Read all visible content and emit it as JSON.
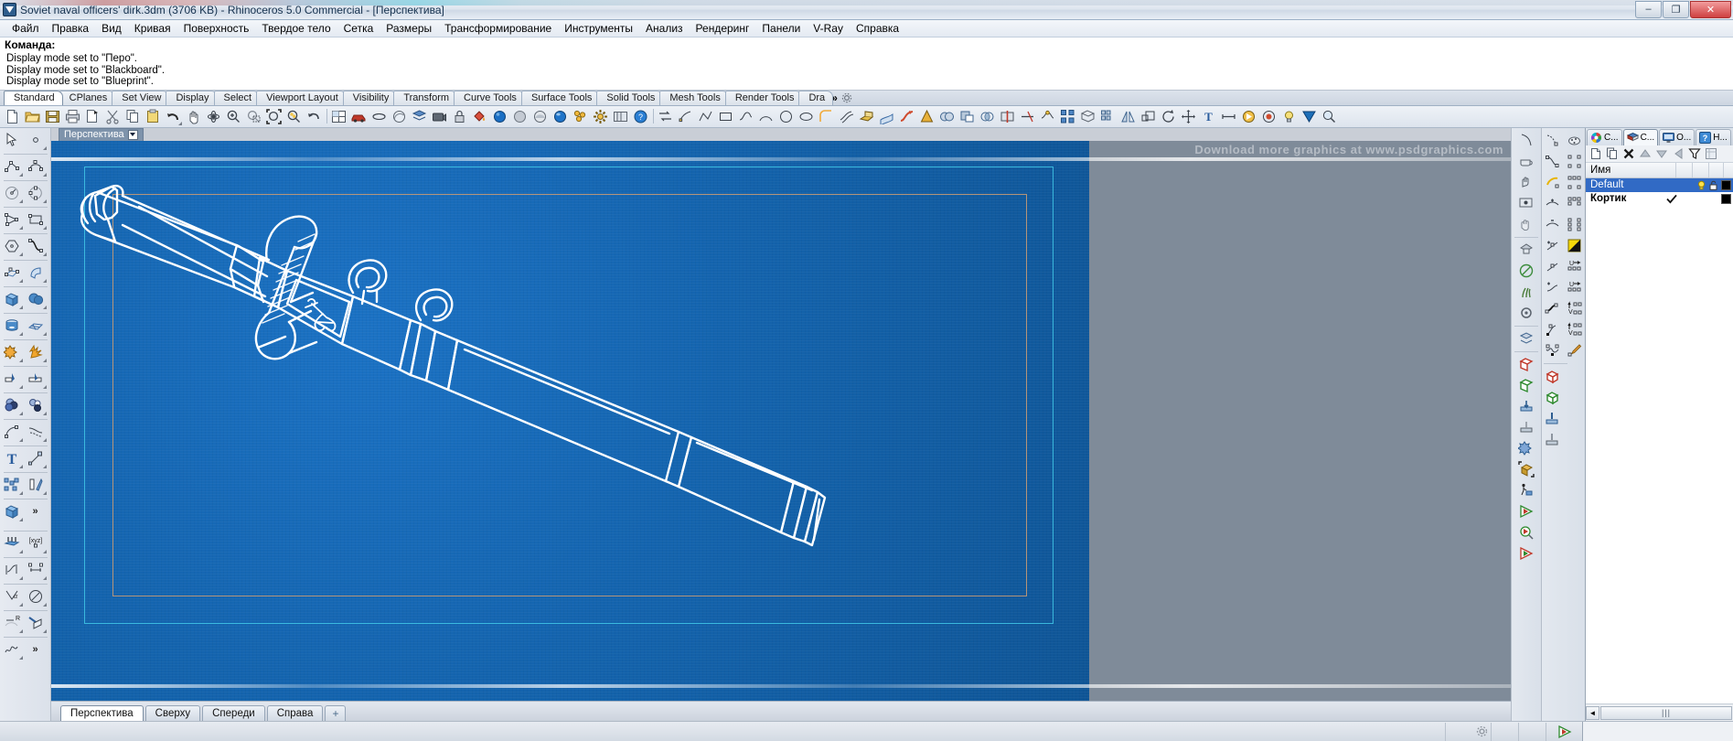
{
  "window": {
    "title": "Soviet naval officers' dirk.3dm (3706 KB) - Rhinoceros 5.0 Commercial - [Перспектива]",
    "icon": "rhino-app-icon",
    "minimize_label": "–",
    "maximize_label": "❐",
    "close_label": "✕"
  },
  "menubar": {
    "items": [
      {
        "label": "Файл"
      },
      {
        "label": "Правка"
      },
      {
        "label": "Вид"
      },
      {
        "label": "Кривая"
      },
      {
        "label": "Поверхность"
      },
      {
        "label": "Твердое тело"
      },
      {
        "label": "Сетка"
      },
      {
        "label": "Размеры"
      },
      {
        "label": "Трансформирование"
      },
      {
        "label": "Инструменты"
      },
      {
        "label": "Анализ"
      },
      {
        "label": "Рендеринг"
      },
      {
        "label": "Панели"
      },
      {
        "label": "V-Ray"
      },
      {
        "label": "Справка"
      }
    ]
  },
  "command_area": {
    "history": [
      "Display mode set to \"Перо\".",
      "Display mode set to \"Blackboard\".",
      "Display mode set to \"Blueprint\"."
    ],
    "prompt_label": "Команда:",
    "prompt_value": ""
  },
  "toolbar_tabs": {
    "items": [
      {
        "label": "Standard",
        "active": true
      },
      {
        "label": "CPlanes",
        "active": false
      },
      {
        "label": "Set View",
        "active": false
      },
      {
        "label": "Display",
        "active": false
      },
      {
        "label": "Select",
        "active": false
      },
      {
        "label": "Viewport Layout",
        "active": false
      },
      {
        "label": "Visibility",
        "active": false
      },
      {
        "label": "Transform",
        "active": false
      },
      {
        "label": "Curve Tools",
        "active": false
      },
      {
        "label": "Surface Tools",
        "active": false
      },
      {
        "label": "Solid Tools",
        "active": false
      },
      {
        "label": "Mesh Tools",
        "active": false
      },
      {
        "label": "Render Tools",
        "active": false
      },
      {
        "label": "Dra",
        "active": false
      }
    ],
    "overflow_label": "»",
    "options_icon": "gear-icon"
  },
  "main_toolbar": {
    "icons": [
      "new-file-icon",
      "open-folder-icon",
      "save-icon",
      "print-icon",
      "copy-to-clipboard-icon",
      "cut-scissors-icon",
      "copy-icon",
      "paste-icon",
      "undo-icon",
      "pan-hand-icon",
      "rotate-view-icon",
      "zoom-in-icon",
      "zoom-window-icon",
      "zoom-extents-icon",
      "zoom-selected-icon",
      "zoom-previous-icon",
      "viewport-layout-icon",
      "render-car-icon",
      "shade-icon",
      "render-preview-icon",
      "layers-icon",
      "camera-icon",
      "lock-icon",
      "paint-bucket-icon",
      "sphere-blue-icon",
      "sphere-grey-icon",
      "cylinder-icon",
      "render-ball-icon",
      "properties-icon",
      "settings-gear-icon",
      "toolbar-icon",
      "help-icon"
    ],
    "right_icons": [
      "arrow-swap-icon",
      "point-icon",
      "polyline-icon",
      "rectangle-icon",
      "curve-icon",
      "arc-icon",
      "circle-icon",
      "ellipse-icon",
      "fillet-icon",
      "offset-icon",
      "extrude-icon",
      "loft-icon",
      "sweep-icon",
      "revolve-icon",
      "boolean-union-icon",
      "boolean-difference-icon",
      "boolean-intersect-icon",
      "split-icon",
      "trim-icon",
      "join-icon",
      "explode-icon",
      "mesh-icon",
      "array-icon",
      "mirror-icon",
      "scale-icon",
      "rotate-icon",
      "move-icon",
      "text-icon",
      "dimension-icon",
      "render-icon",
      "material-icon",
      "light-icon",
      "vray-icon",
      "analyze-icon"
    ]
  },
  "left_toolbar": {
    "rows": [
      [
        "select-arrow-icon",
        "point-icon"
      ],
      [
        "polyline-icon",
        "control-point-curve-icon"
      ],
      [
        "circle-icon",
        "ellipse-icon"
      ],
      [
        "arc-icon",
        "rectangle-icon"
      ],
      [
        "polygon-icon",
        "curve-interpolate-icon"
      ],
      [
        "surface-from-points-icon",
        "surface-extrude-icon"
      ],
      [
        "box-icon",
        "sphere-icon"
      ],
      [
        "cylinder-icon",
        "surface-network-icon"
      ],
      [
        "boolean-union-icon",
        "explode-icon"
      ],
      [
        "split-icon",
        "trim-icon"
      ],
      [
        "boolean-2obj-icon",
        "boolean-difference-icon"
      ],
      [
        "fillet-curve-icon",
        "offset-curve-icon"
      ],
      [
        "text-icon",
        "scale-icon"
      ],
      [
        "array-icon",
        "mirror-icon"
      ],
      [
        "solid-tools-icon",
        "more-tools-icon"
      ]
    ],
    "rows2": [
      [
        "extrude-surface-icon",
        "cplane-xyz-icon"
      ],
      [
        "dim-aligned-icon",
        "dim-linear-icon"
      ],
      [
        "dim-angle-icon",
        "dim-diameter-icon"
      ],
      [
        "dim-radius-icon",
        "dim-leader-icon"
      ],
      [
        "curve-blend-icon",
        "more-tools-icon"
      ]
    ],
    "overflow_label": "»"
  },
  "viewport": {
    "name": "Перспектива",
    "dropdown_icon": "chevron-down-icon",
    "watermark": "Download more graphics at www.psdgraphics.com",
    "background_color": "#1464ae",
    "frame_cyan_color": "#41c8e8",
    "frame_tan_color": "#c79a74",
    "line_color": "#ffffff",
    "display_mode": "Blueprint",
    "model_name": "Soviet naval officers' dirk",
    "tabs": [
      {
        "label": "Перспектива",
        "active": true
      },
      {
        "label": "Сверху",
        "active": false
      },
      {
        "label": "Спереди",
        "active": false
      },
      {
        "label": "Справа",
        "active": false
      },
      {
        "label": "+",
        "active": false
      }
    ]
  },
  "layer_panel": {
    "tabs": [
      {
        "label": "C...",
        "icon": "color-wheel-icon",
        "active": false
      },
      {
        "label": "C...",
        "icon": "layers-stack-icon",
        "active": true
      },
      {
        "label": "O...",
        "icon": "display-monitor-icon",
        "active": false
      },
      {
        "label": "H...",
        "icon": "help-question-icon",
        "active": false
      }
    ],
    "toolbar": [
      "new-layer-icon",
      "duplicate-layer-icon",
      "delete-layer-icon",
      "move-up-icon",
      "move-down-icon",
      "move-left-icon",
      "filter-icon",
      "properties-grid-icon"
    ],
    "columns": [
      "Имя"
    ],
    "rows": [
      {
        "name": "Default",
        "selected": true,
        "bold": false,
        "current": false,
        "visible": true,
        "locked": false,
        "color": "#000000"
      },
      {
        "name": "Кортик",
        "selected": false,
        "bold": true,
        "current": true,
        "visible": true,
        "locked": false,
        "color": "#000000"
      }
    ],
    "scroll": {
      "left_arrow": "◄",
      "thumb_label": "|||"
    }
  },
  "statusbar": {
    "gear_icon": "gear-icon",
    "vray_icon": "vray-render-icon"
  }
}
